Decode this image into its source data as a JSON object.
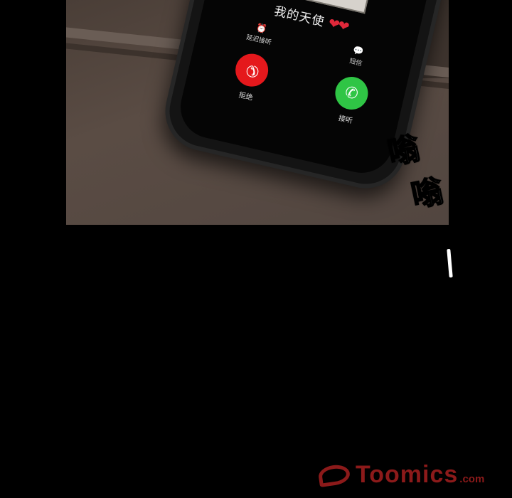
{
  "incoming_call": {
    "caller_name": "我的天使",
    "hearts": "❤❤",
    "remind_label": "延迟接听",
    "remind_icon": "alarm-clock-icon",
    "message_label": "短信",
    "message_icon": "speech-bubble-icon",
    "decline_label": "拒绝",
    "decline_icon": "phone-hangup-icon",
    "accept_label": "接听",
    "accept_icon": "phone-icon"
  },
  "colors": {
    "decline": "#e5181c",
    "accept": "#2fc545",
    "hearts": "#e0283a",
    "watermark": "#8c1a1a"
  },
  "sound_effects": [
    "嗡",
    "嗡"
  ],
  "watermark": {
    "brand": "Toomics",
    "tld": ".com"
  }
}
